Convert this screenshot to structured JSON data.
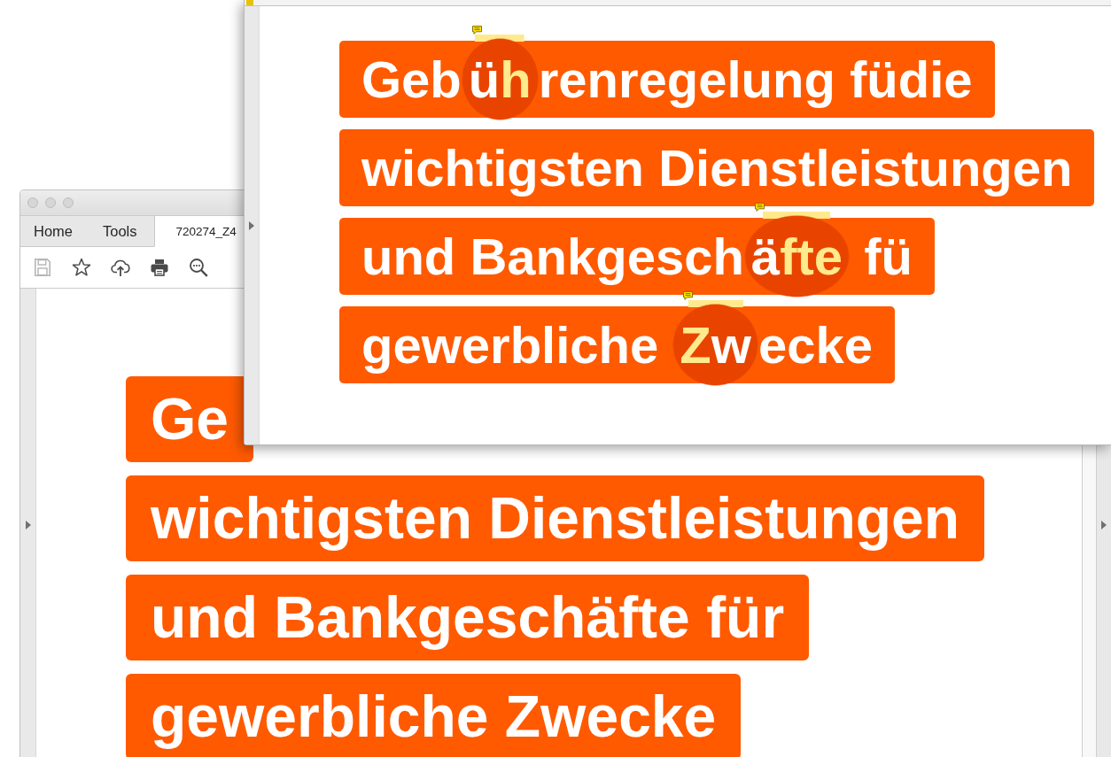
{
  "back_window": {
    "tabs": [
      {
        "label": "Home",
        "selected": false
      },
      {
        "label": "Tools",
        "selected": false
      },
      {
        "label": "720274_Z4",
        "selected": true
      }
    ],
    "toolbar": [
      {
        "kind": "save",
        "disabled": true
      },
      {
        "kind": "bookmark",
        "disabled": false
      },
      {
        "kind": "upload",
        "disabled": false
      },
      {
        "kind": "print",
        "disabled": false
      },
      {
        "kind": "zoom",
        "disabled": false
      }
    ],
    "page": {
      "lines": [
        "Ge",
        "wichtigsten Dienstleistungen",
        "und Bankgeschäfte für",
        "gewerbliche Zwecke"
      ]
    }
  },
  "front_window": {
    "page": {
      "lines": [
        {
          "segments": [
            {
              "kind": "text",
              "text": "Geb"
            },
            {
              "kind": "highlight",
              "parts": [
                {
                  "text": "ü",
                  "color": "#ffffff"
                },
                {
                  "text": "h",
                  "color": "#ffea8c"
                }
              ]
            },
            {
              "kind": "text",
              "text": "renregelung füdie"
            }
          ]
        },
        {
          "segments": [
            {
              "kind": "text",
              "text": "wichtigsten Dienstleistungen"
            }
          ]
        },
        {
          "segments": [
            {
              "kind": "text",
              "text": "und Bankgesch"
            },
            {
              "kind": "highlight",
              "parts": [
                {
                  "text": "ä",
                  "color": "#ffffff"
                },
                {
                  "text": "fte",
                  "color": "#ffea8c"
                }
              ]
            },
            {
              "kind": "text",
              "text": " fü"
            }
          ]
        },
        {
          "segments": [
            {
              "kind": "text",
              "text": "gewerbliche "
            },
            {
              "kind": "highlight",
              "parts": [
                {
                  "text": "Z",
                  "color": "#ffea8c"
                },
                {
                  "text": "w",
                  "color": "#ffffff"
                }
              ]
            },
            {
              "kind": "text",
              "text": "ecke"
            }
          ]
        }
      ]
    }
  }
}
